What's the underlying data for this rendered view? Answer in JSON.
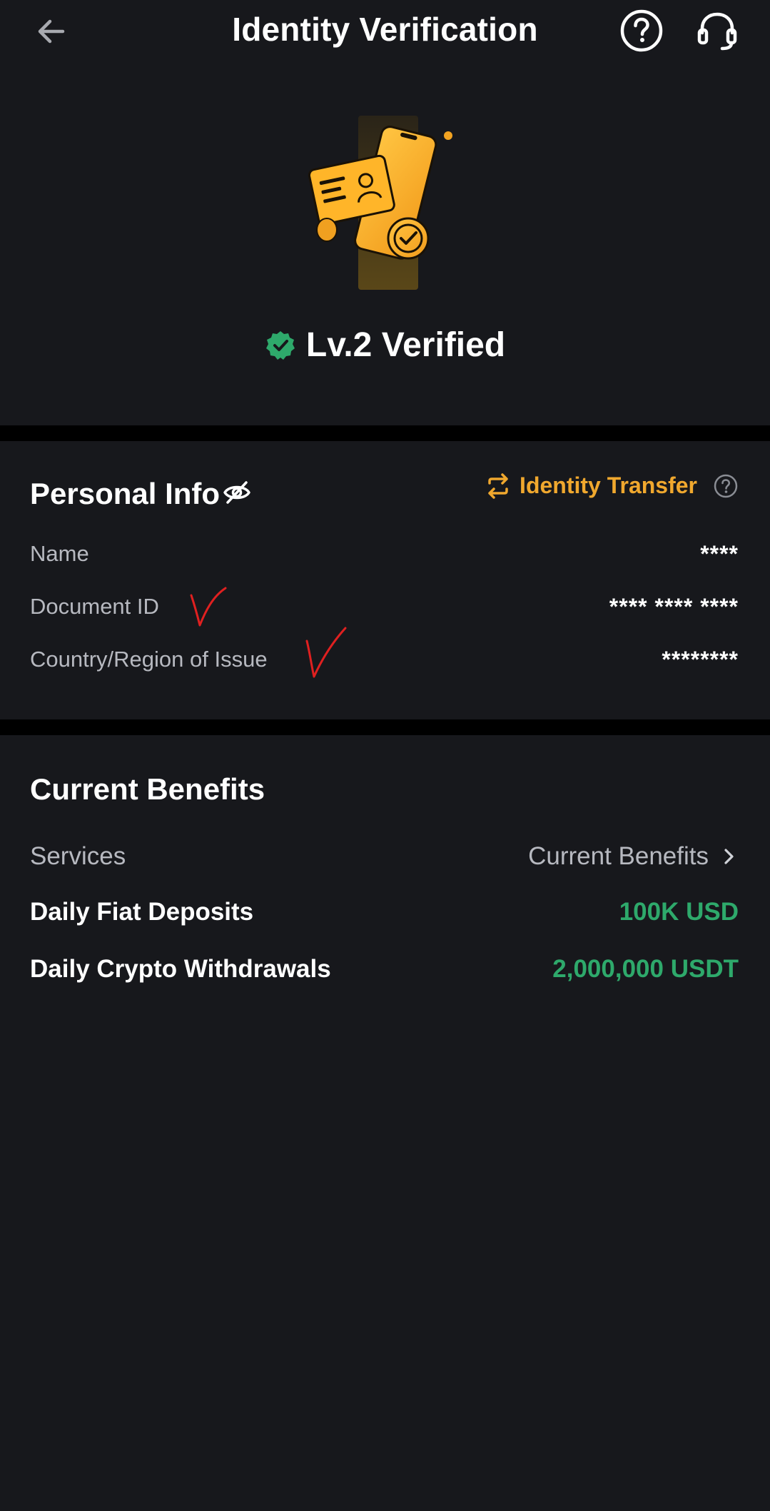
{
  "header": {
    "title": "Identity Verification",
    "back_icon": "arrow-left-icon",
    "help_icon": "question-circle-icon",
    "support_icon": "headset-icon"
  },
  "hero": {
    "status_text": "Lv.2 Verified",
    "status_icon": "verified-badge-icon",
    "illustration": "phone-id-card-icon"
  },
  "personal_info": {
    "title": "Personal Info",
    "hide_icon": "eye-off-icon",
    "transfer_label": "Identity Transfer",
    "transfer_icon": "swap-arrows-icon",
    "transfer_help_icon": "question-circle-icon",
    "rows": [
      {
        "label": "Name",
        "value": "****"
      },
      {
        "label": "Document ID",
        "value": "**** **** ****"
      },
      {
        "label": "Country/Region of Issue",
        "value": "********"
      }
    ]
  },
  "benefits": {
    "title": "Current Benefits",
    "services_label": "Services",
    "services_link": "Current Benefits",
    "link_icon": "chevron-right-icon",
    "rows": [
      {
        "label": "Daily Fiat Deposits",
        "value": "100K USD"
      },
      {
        "label": "Daily Crypto Withdrawals",
        "value": "2,000,000 USDT"
      }
    ]
  },
  "colors": {
    "background": "#17181c",
    "divider": "#000000",
    "accent": "#f0a82e",
    "positive": "#2ea96b",
    "muted_text": "#b7b9c0",
    "annotation": "#e02020"
  }
}
